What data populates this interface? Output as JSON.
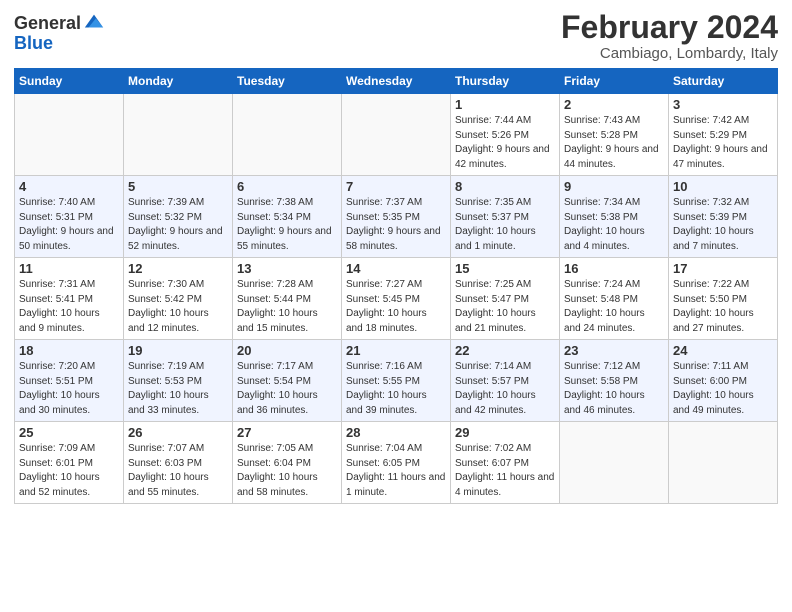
{
  "header": {
    "logo_general": "General",
    "logo_blue": "Blue",
    "month_title": "February 2024",
    "location": "Cambiago, Lombardy, Italy"
  },
  "days_of_week": [
    "Sunday",
    "Monday",
    "Tuesday",
    "Wednesday",
    "Thursday",
    "Friday",
    "Saturday"
  ],
  "weeks": [
    [
      {
        "day": "",
        "info": ""
      },
      {
        "day": "",
        "info": ""
      },
      {
        "day": "",
        "info": ""
      },
      {
        "day": "",
        "info": ""
      },
      {
        "day": "1",
        "info": "Sunrise: 7:44 AM\nSunset: 5:26 PM\nDaylight: 9 hours\nand 42 minutes."
      },
      {
        "day": "2",
        "info": "Sunrise: 7:43 AM\nSunset: 5:28 PM\nDaylight: 9 hours\nand 44 minutes."
      },
      {
        "day": "3",
        "info": "Sunrise: 7:42 AM\nSunset: 5:29 PM\nDaylight: 9 hours\nand 47 minutes."
      }
    ],
    [
      {
        "day": "4",
        "info": "Sunrise: 7:40 AM\nSunset: 5:31 PM\nDaylight: 9 hours\nand 50 minutes."
      },
      {
        "day": "5",
        "info": "Sunrise: 7:39 AM\nSunset: 5:32 PM\nDaylight: 9 hours\nand 52 minutes."
      },
      {
        "day": "6",
        "info": "Sunrise: 7:38 AM\nSunset: 5:34 PM\nDaylight: 9 hours\nand 55 minutes."
      },
      {
        "day": "7",
        "info": "Sunrise: 7:37 AM\nSunset: 5:35 PM\nDaylight: 9 hours\nand 58 minutes."
      },
      {
        "day": "8",
        "info": "Sunrise: 7:35 AM\nSunset: 5:37 PM\nDaylight: 10 hours\nand 1 minute."
      },
      {
        "day": "9",
        "info": "Sunrise: 7:34 AM\nSunset: 5:38 PM\nDaylight: 10 hours\nand 4 minutes."
      },
      {
        "day": "10",
        "info": "Sunrise: 7:32 AM\nSunset: 5:39 PM\nDaylight: 10 hours\nand 7 minutes."
      }
    ],
    [
      {
        "day": "11",
        "info": "Sunrise: 7:31 AM\nSunset: 5:41 PM\nDaylight: 10 hours\nand 9 minutes."
      },
      {
        "day": "12",
        "info": "Sunrise: 7:30 AM\nSunset: 5:42 PM\nDaylight: 10 hours\nand 12 minutes."
      },
      {
        "day": "13",
        "info": "Sunrise: 7:28 AM\nSunset: 5:44 PM\nDaylight: 10 hours\nand 15 minutes."
      },
      {
        "day": "14",
        "info": "Sunrise: 7:27 AM\nSunset: 5:45 PM\nDaylight: 10 hours\nand 18 minutes."
      },
      {
        "day": "15",
        "info": "Sunrise: 7:25 AM\nSunset: 5:47 PM\nDaylight: 10 hours\nand 21 minutes."
      },
      {
        "day": "16",
        "info": "Sunrise: 7:24 AM\nSunset: 5:48 PM\nDaylight: 10 hours\nand 24 minutes."
      },
      {
        "day": "17",
        "info": "Sunrise: 7:22 AM\nSunset: 5:50 PM\nDaylight: 10 hours\nand 27 minutes."
      }
    ],
    [
      {
        "day": "18",
        "info": "Sunrise: 7:20 AM\nSunset: 5:51 PM\nDaylight: 10 hours\nand 30 minutes."
      },
      {
        "day": "19",
        "info": "Sunrise: 7:19 AM\nSunset: 5:53 PM\nDaylight: 10 hours\nand 33 minutes."
      },
      {
        "day": "20",
        "info": "Sunrise: 7:17 AM\nSunset: 5:54 PM\nDaylight: 10 hours\nand 36 minutes."
      },
      {
        "day": "21",
        "info": "Sunrise: 7:16 AM\nSunset: 5:55 PM\nDaylight: 10 hours\nand 39 minutes."
      },
      {
        "day": "22",
        "info": "Sunrise: 7:14 AM\nSunset: 5:57 PM\nDaylight: 10 hours\nand 42 minutes."
      },
      {
        "day": "23",
        "info": "Sunrise: 7:12 AM\nSunset: 5:58 PM\nDaylight: 10 hours\nand 46 minutes."
      },
      {
        "day": "24",
        "info": "Sunrise: 7:11 AM\nSunset: 6:00 PM\nDaylight: 10 hours\nand 49 minutes."
      }
    ],
    [
      {
        "day": "25",
        "info": "Sunrise: 7:09 AM\nSunset: 6:01 PM\nDaylight: 10 hours\nand 52 minutes."
      },
      {
        "day": "26",
        "info": "Sunrise: 7:07 AM\nSunset: 6:03 PM\nDaylight: 10 hours\nand 55 minutes."
      },
      {
        "day": "27",
        "info": "Sunrise: 7:05 AM\nSunset: 6:04 PM\nDaylight: 10 hours\nand 58 minutes."
      },
      {
        "day": "28",
        "info": "Sunrise: 7:04 AM\nSunset: 6:05 PM\nDaylight: 11 hours\nand 1 minute."
      },
      {
        "day": "29",
        "info": "Sunrise: 7:02 AM\nSunset: 6:07 PM\nDaylight: 11 hours\nand 4 minutes."
      },
      {
        "day": "",
        "info": ""
      },
      {
        "day": "",
        "info": ""
      }
    ]
  ]
}
